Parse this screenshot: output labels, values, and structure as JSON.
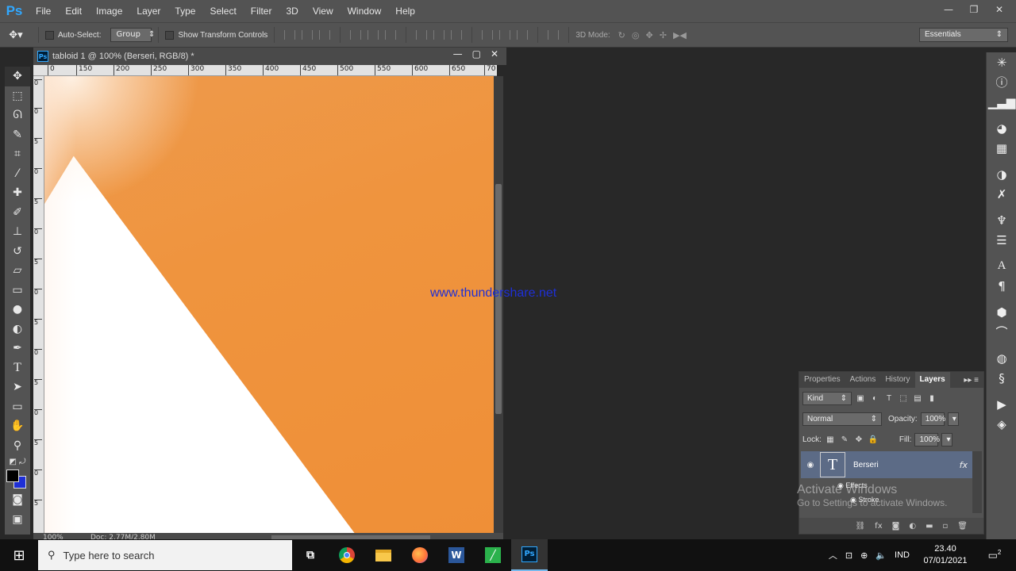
{
  "menubar": {
    "logo": "Ps",
    "items": [
      "File",
      "Edit",
      "Image",
      "Layer",
      "Type",
      "Select",
      "Filter",
      "3D",
      "View",
      "Window",
      "Help"
    ],
    "window_controls": [
      "—",
      "❐",
      "✕"
    ]
  },
  "options_bar": {
    "auto_select_label": "Auto-Select:",
    "auto_select_value": "Group",
    "show_transform_label": "Show Transform Controls",
    "mode_3d_label": "3D Mode:",
    "workspace": "Essentials"
  },
  "tools": [
    "move",
    "marquee",
    "lasso",
    "quick-select",
    "crop",
    "eyedropper",
    "healing",
    "brush",
    "clone-stamp",
    "history-brush",
    "eraser",
    "gradient",
    "blur",
    "dodge",
    "pen",
    "type",
    "path-select",
    "rectangle",
    "hand",
    "zoom"
  ],
  "document": {
    "title": "tabloid 1 @ 100% (Berseri, RGB/8) *",
    "ruler_top": [
      "0",
      "150",
      "200",
      "250",
      "300",
      "350",
      "400",
      "450",
      "500",
      "550",
      "600",
      "650",
      "70"
    ],
    "ruler_left": [
      "0",
      "0",
      "5",
      "0",
      "5",
      "0",
      "5",
      "0",
      "5",
      "0",
      "5",
      "0",
      "5",
      "0",
      "5"
    ],
    "status_zoom": "100%",
    "status_doc": "Doc: 2.77M/2.80M"
  },
  "watermark": "www.thundershare.net",
  "layers_panel": {
    "tabs": [
      "Properties",
      "Actions",
      "History",
      "Layers"
    ],
    "active_tab": "Layers",
    "filter_kind": "Kind",
    "blend_mode": "Normal",
    "opacity_label": "Opacity:",
    "opacity_value": "100%",
    "lock_label": "Lock:",
    "fill_label": "Fill:",
    "fill_value": "100%",
    "layer": {
      "thumb": "T",
      "name": "Berseri",
      "fx": "fx",
      "effects_label": "Effects",
      "stroke_label": "Stroke"
    }
  },
  "activate_windows": {
    "title": "Activate Windows",
    "subtitle": "Go to Settings to activate Windows."
  },
  "taskbar": {
    "search_placeholder": "Type here to search",
    "apps": [
      "Task View",
      "Chrome",
      "File Explorer",
      "Firefox",
      "Word",
      "App",
      "Ps"
    ],
    "language": "IND",
    "time": "23.40",
    "date": "07/01/2021",
    "notifications": "2"
  }
}
